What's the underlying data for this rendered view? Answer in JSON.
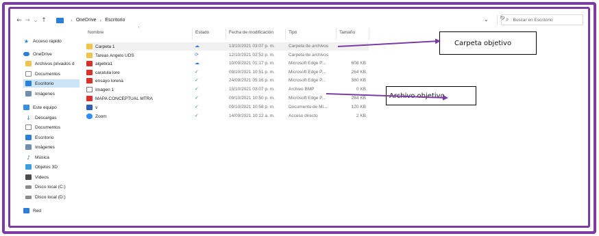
{
  "colors": {
    "annotation": "#7b3aa4",
    "selection": "#cce4f7",
    "accent": "#2b7fd6",
    "synced": "#2e9e48"
  },
  "address": {
    "back_icon": "arrow-left-icon",
    "forward_icon": "arrow-right-icon",
    "recent_icon": "chevron-down-icon",
    "up_icon": "arrow-up-icon",
    "crumbs": [
      "OneDrive",
      "Escritorio"
    ],
    "separator": "›",
    "dropdown_icon": "chevron-down-icon",
    "refresh_icon": "refresh-icon",
    "search_placeholder": "Buscar en Escritorio"
  },
  "sidebar": {
    "items": [
      {
        "label": "Acceso rápido",
        "icon": "star-icon"
      },
      {
        "label": "OneDrive",
        "icon": "cloud-icon"
      },
      {
        "label": "Archivos privados d",
        "icon": "folder-icon"
      },
      {
        "label": "Documentos",
        "icon": "document-icon"
      },
      {
        "label": "Escritorio",
        "icon": "desktop-icon",
        "selected": true
      },
      {
        "label": "Imágenes",
        "icon": "pictures-icon"
      },
      {
        "label": "Este equipo",
        "icon": "computer-icon"
      },
      {
        "label": "Descargas",
        "icon": "download-icon"
      },
      {
        "label": "Documentos",
        "icon": "document-icon"
      },
      {
        "label": "Escritorio",
        "icon": "desktop-icon"
      },
      {
        "label": "Imágenes",
        "icon": "pictures-icon"
      },
      {
        "label": "Música",
        "icon": "music-icon"
      },
      {
        "label": "Objetos 3D",
        "icon": "cube-icon"
      },
      {
        "label": "Videos",
        "icon": "video-icon"
      },
      {
        "label": "Disco local (C:)",
        "icon": "drive-icon"
      },
      {
        "label": "Disco local (D:)",
        "icon": "drive-icon"
      },
      {
        "label": "Red",
        "icon": "network-icon"
      }
    ]
  },
  "columns": {
    "name": "Nombre",
    "status": "Estado",
    "date": "Fecha de modificación",
    "type": "Tipo",
    "size": "Tamaño",
    "sort_icon": "sort-up-icon"
  },
  "files": [
    {
      "name": "Carpeta 1",
      "status": "☁",
      "date": "13/10/2021 03:07 p. m.",
      "type": "Carpeta de archivos",
      "size": "",
      "icon": "folder-icon",
      "status_icon": "cloud-status-icon"
    },
    {
      "name": "Tareas Angelo UDS",
      "status": "⟳",
      "date": "12/10/2021 02:52 p. m.",
      "type": "Carpeta de archivos",
      "size": "",
      "icon": "folder-icon",
      "status_icon": "sync-icon"
    },
    {
      "name": "algebra1",
      "status": "☁",
      "date": "10/09/2021 01:17 p. m.",
      "type": "Microsoft Edge P...",
      "size": "608 KB",
      "icon": "pdf-icon",
      "status_icon": "cloud-status-icon"
    },
    {
      "name": "caratula lore",
      "status": "✓",
      "date": "09/10/2021 10:51 p. m.",
      "type": "Microsoft Edge P...",
      "size": "264 KB",
      "icon": "pdf-icon",
      "status_icon": "check-icon"
    },
    {
      "name": "ensayo lorena",
      "status": "✓",
      "date": "24/09/2021 05:16 p. m.",
      "type": "Microsoft Edge P...",
      "size": "380 KB",
      "icon": "pdf-icon",
      "status_icon": "check-icon"
    },
    {
      "name": "Imagen 1",
      "status": "✓",
      "date": "13/10/2021 03:07 p. m.",
      "type": "Archivo BMP",
      "size": "0 KB",
      "icon": "image-file-icon",
      "status_icon": "check-icon"
    },
    {
      "name": "MAPA CONCEPTUAL MTRA",
      "status": "✓",
      "date": "09/10/2021 10:50 p. m.",
      "type": "Microsoft Edge P...",
      "size": "284 KB",
      "icon": "pdf-icon",
      "status_icon": "check-icon"
    },
    {
      "name": "v",
      "status": "✓",
      "date": "09/10/2021 10:58 p. m.",
      "type": "Documento de Mi...",
      "size": "120 KB",
      "icon": "word-icon",
      "status_icon": "check-icon"
    },
    {
      "name": "Zoom",
      "status": "✓",
      "date": "14/09/2021 10:12 a. m.",
      "type": "Acceso directo",
      "size": "2 KB",
      "icon": "zoom-shortcut-icon",
      "status_icon": "check-icon"
    }
  ],
  "annotations": {
    "folder_target": "Carpeta objetivo",
    "file_target": "Archivo objetivo."
  }
}
